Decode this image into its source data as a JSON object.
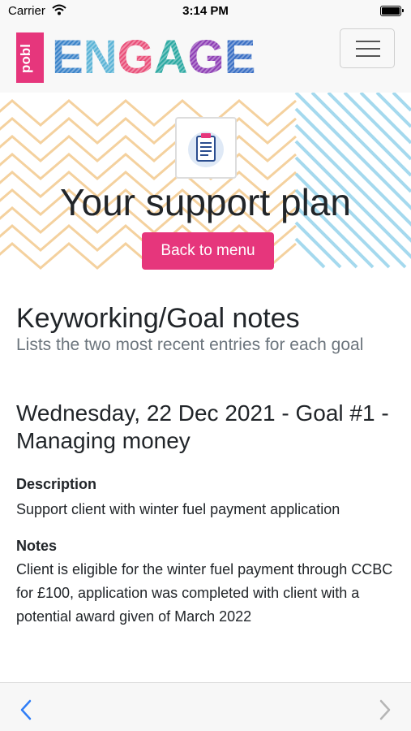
{
  "status_bar": {
    "carrier": "Carrier",
    "time": "3:14 PM"
  },
  "navbar": {
    "logo_box_text": "pobl",
    "logo_word": "ENGAGE"
  },
  "hero": {
    "title": "Your support plan",
    "back_button": "Back to menu"
  },
  "section": {
    "title": "Keyworking/Goal notes",
    "subtitle": "Lists the two most recent entries for each goal"
  },
  "entry": {
    "title": "Wednesday, 22 Dec 2021 - Goal #1 - Managing money",
    "description_label": "Description",
    "description": "Support client with winter fuel payment application",
    "notes_label": "Notes",
    "notes": "Client is eligible for the winter fuel payment through CCBC for £100, application was completed with client with a potential award given of March 2022"
  },
  "colors": {
    "accent": "#e6367c"
  }
}
